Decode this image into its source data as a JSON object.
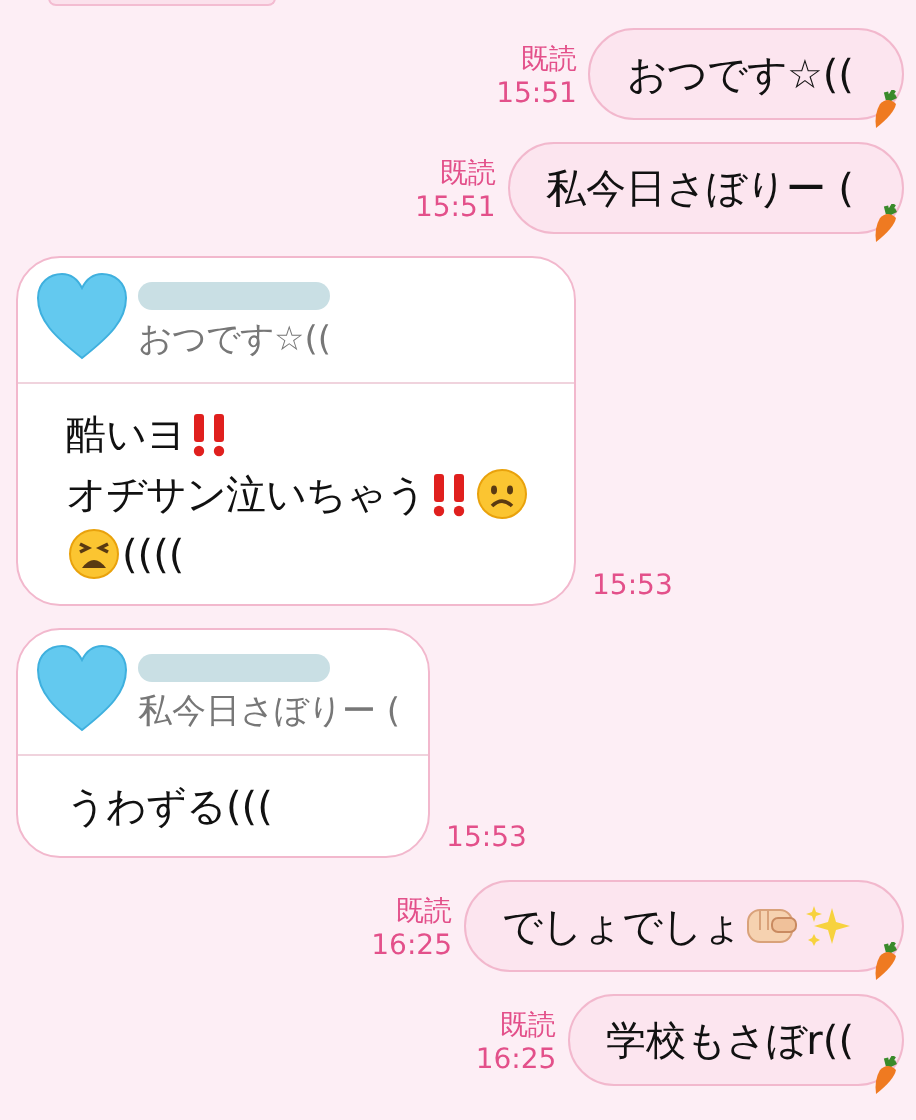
{
  "messages": [
    {
      "kind": "clipped"
    },
    {
      "kind": "sent",
      "read": "既読",
      "time": "15:51",
      "lines": [
        [
          {
            "kind": "text",
            "text": "おつです☆(("
          }
        ]
      ]
    },
    {
      "kind": "sent",
      "read": "既読",
      "time": "15:51",
      "lines": [
        [
          {
            "kind": "text",
            "text": "私今日さぼりー ("
          }
        ]
      ]
    },
    {
      "kind": "received",
      "quote": "おつです☆((",
      "time": "15:53",
      "lines": [
        [
          {
            "kind": "text",
            "text": "酷いヨ"
          },
          {
            "kind": "exclaim"
          }
        ],
        [
          {
            "kind": "text",
            "text": "オヂサン泣いちゃう"
          },
          {
            "kind": "exclaim"
          },
          {
            "kind": "frown"
          }
        ],
        [
          {
            "kind": "tired"
          },
          {
            "kind": "text",
            "text": "(((("
          }
        ]
      ]
    },
    {
      "kind": "received",
      "quote": "私今日さぼりー (",
      "time": "15:53",
      "lines": [
        [
          {
            "kind": "text",
            "text": "うわずる((("
          }
        ]
      ]
    },
    {
      "kind": "sent",
      "read": "既読",
      "time": "16:25",
      "lines": [
        [
          {
            "kind": "text",
            "text": "でしょでしょ"
          },
          {
            "kind": "fist"
          },
          {
            "kind": "sparkles"
          }
        ]
      ]
    },
    {
      "kind": "sent",
      "read": "既読",
      "time": "16:25",
      "lines": [
        [
          {
            "kind": "text",
            "text": "学校もさぼr(("
          }
        ]
      ]
    }
  ]
}
